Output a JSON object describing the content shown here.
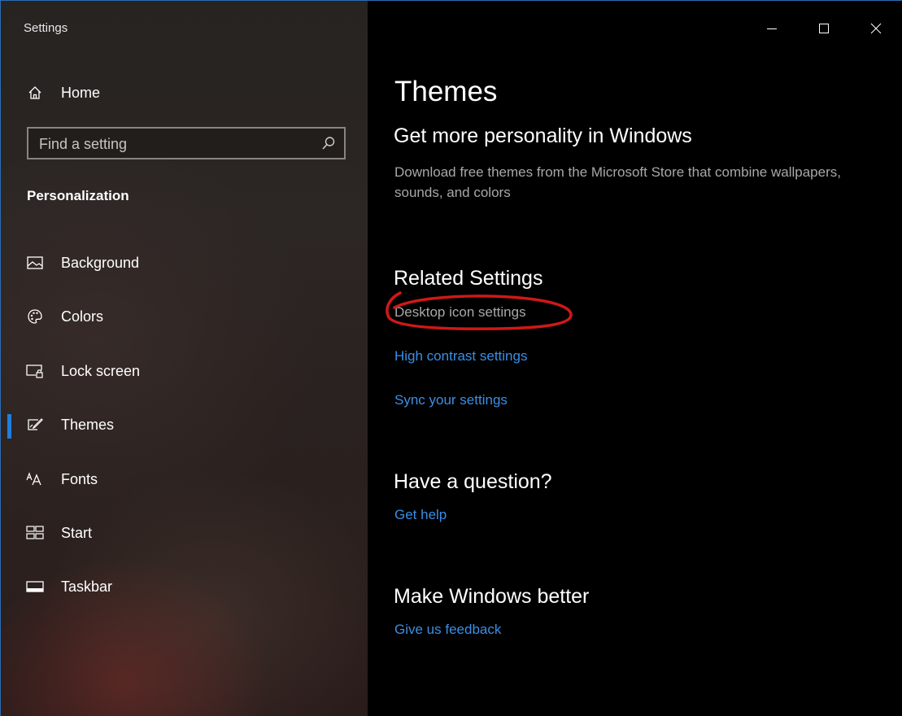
{
  "window": {
    "title": "Settings",
    "minimize_glyph": "—",
    "maximize_glyph": "☐",
    "close_glyph": "✕"
  },
  "sidebar": {
    "home_label": "Home",
    "search_placeholder": "Find a setting",
    "section_title": "Personalization",
    "items": [
      {
        "label": "Background",
        "icon": "picture-icon"
      },
      {
        "label": "Colors",
        "icon": "palette-icon"
      },
      {
        "label": "Lock screen",
        "icon": "lock-screen-icon"
      },
      {
        "label": "Themes",
        "icon": "themes-brush-icon",
        "selected": true
      },
      {
        "label": "Fonts",
        "icon": "fonts-icon"
      },
      {
        "label": "Start",
        "icon": "start-tiles-icon"
      },
      {
        "label": "Taskbar",
        "icon": "taskbar-icon"
      }
    ]
  },
  "main": {
    "page_title": "Themes",
    "personality": {
      "heading": "Get more personality in Windows",
      "description": "Download free themes from the Microsoft Store that combine wallpapers, sounds, and colors"
    },
    "related": {
      "heading": "Related Settings",
      "links": [
        "Desktop icon settings",
        "High contrast settings",
        "Sync your settings"
      ]
    },
    "question": {
      "heading": "Have a question?",
      "link": "Get help"
    },
    "feedback": {
      "heading": "Make Windows better",
      "link": "Give us feedback"
    }
  },
  "colors": {
    "accent": "#1f7fe0",
    "link": "#3a8fe6",
    "annotation": "#d01818"
  }
}
